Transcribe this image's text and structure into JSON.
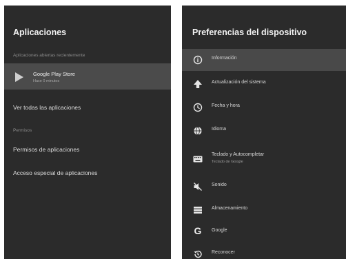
{
  "left": {
    "title": "Aplicaciones",
    "recent_header": "Aplicaciones abiertas recientemente",
    "recent_app": {
      "name": "Google Play Store",
      "subtitle": "Hace 0 minutos"
    },
    "see_all": "Ver todas las aplicaciones",
    "perms_header": "Permisos",
    "app_permissions": "Permisos de aplicaciones",
    "special_access": "Acceso especial de aplicaciones"
  },
  "right": {
    "title": "Preferencias del dispositivo",
    "items": [
      {
        "label": "Información",
        "subtitle": "",
        "icon": "info-icon"
      },
      {
        "label": "Actualización del sistema",
        "subtitle": "",
        "icon": "system-update-icon"
      },
      {
        "label": "Fecha y hora",
        "subtitle": "",
        "icon": "clock-icon"
      },
      {
        "label": "Idioma",
        "subtitle": "",
        "icon": "globe-icon"
      },
      {
        "label": "Teclado y Autocompletar",
        "subtitle": "Teclado de Google",
        "icon": "keyboard-icon"
      },
      {
        "label": "Sonido",
        "subtitle": "",
        "icon": "sound-icon"
      },
      {
        "label": "Almacenamiento",
        "subtitle": "",
        "icon": "storage-icon"
      },
      {
        "label": "Google",
        "subtitle": "",
        "icon": "google-icon"
      },
      {
        "label": "Reconocer",
        "subtitle": "",
        "icon": "restore-icon"
      }
    ]
  },
  "colors": {
    "panel_bg": "#2b2b2b",
    "selected_bg": "#494949",
    "text": "#d8d8d8",
    "muted": "#8a8a8a"
  }
}
